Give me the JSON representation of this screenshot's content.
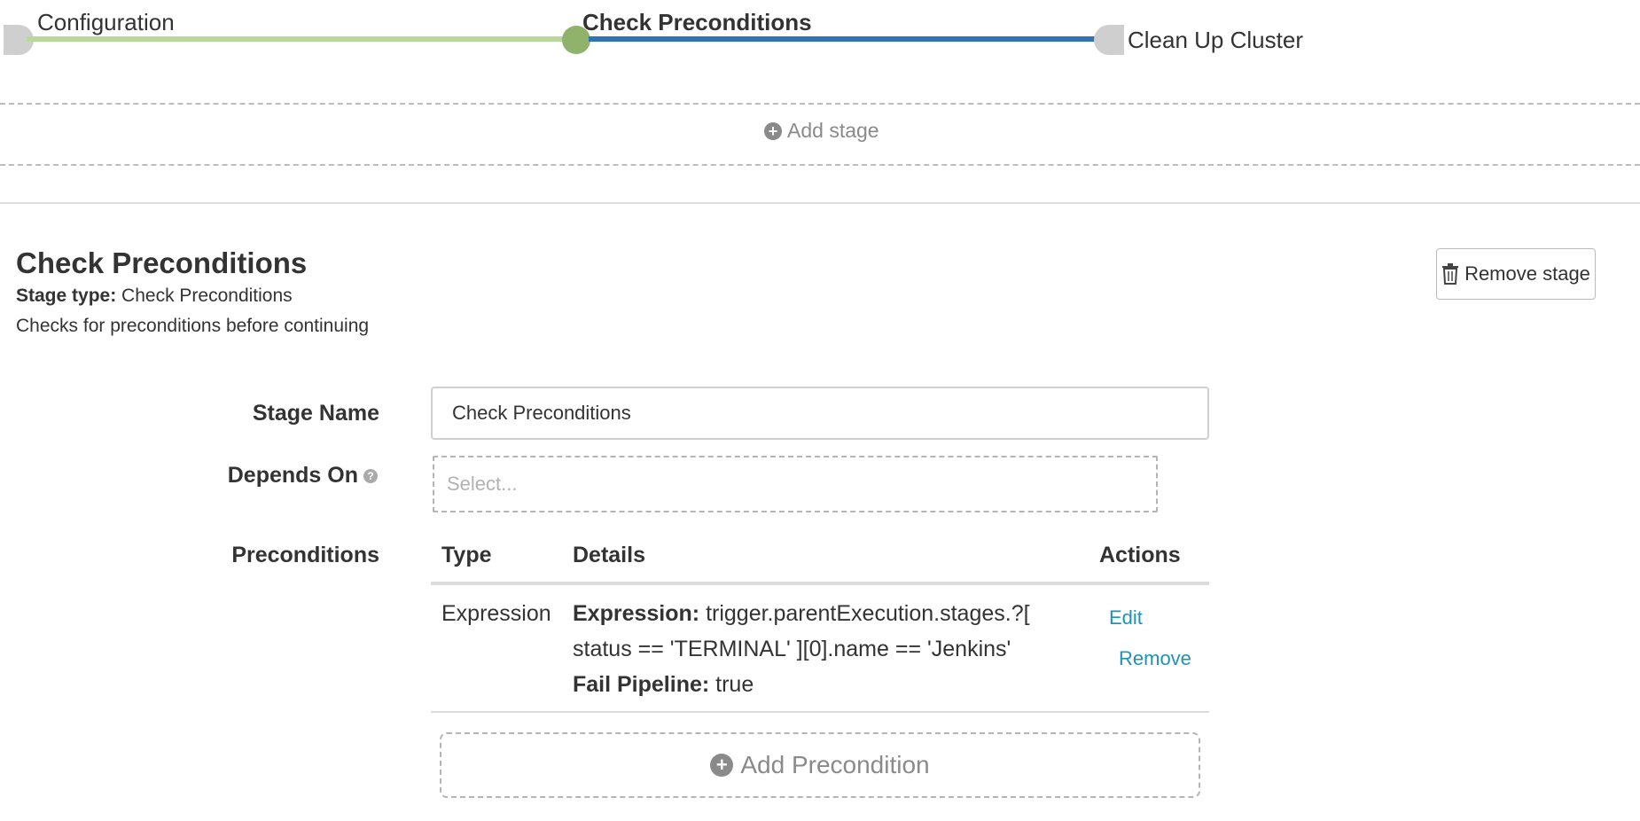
{
  "pipeline": {
    "stages": [
      {
        "label": "Configuration"
      },
      {
        "label": "Check Preconditions"
      },
      {
        "label": "Clean Up Cluster"
      }
    ],
    "add_stage_label": "Add stage",
    "colors": {
      "done": "#b9d79b",
      "active": "#2f74b5",
      "node_active": "#8fb36a",
      "node_inactive": "#cfcfcf"
    }
  },
  "stage": {
    "title": "Check Preconditions",
    "type_label": "Stage type:",
    "type_value": "Check Preconditions",
    "description": "Checks for preconditions before continuing",
    "remove_button_label": "Remove stage",
    "remove_icon": "trash-icon"
  },
  "form": {
    "stage_name_label": "Stage Name",
    "stage_name_value": "Check Preconditions",
    "depends_on_label": "Depends On",
    "depends_on_placeholder": "Select...",
    "preconditions_label": "Preconditions"
  },
  "preconditions_table": {
    "headers": {
      "type": "Type",
      "details": "Details",
      "actions": "Actions"
    },
    "rows": [
      {
        "type": "Expression",
        "expression_label": "Expression:",
        "expression_line1": "trigger.parentExecution.stages.?[",
        "expression_line2": "status == 'TERMINAL' ][0].name == 'Jenkins'",
        "fail_label": "Fail Pipeline:",
        "fail_value": "true",
        "edit_label": "Edit",
        "remove_label": "Remove"
      }
    ],
    "add_label": "Add Precondition"
  },
  "accent_link_color": "#1e93b8"
}
